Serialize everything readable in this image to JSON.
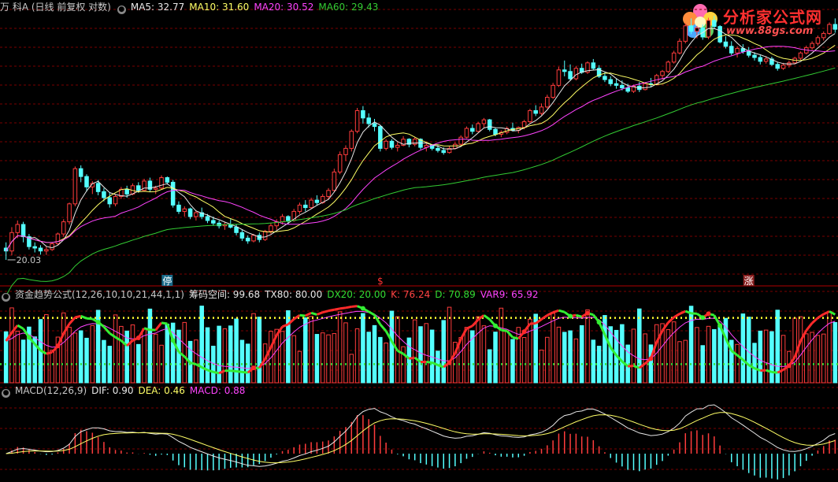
{
  "colors": {
    "background": "#000000",
    "grid": "#7a0000",
    "up": "#ff3c3c",
    "down": "#54ffff",
    "ma5": "#e8e8e8",
    "ma10": "#ffff66",
    "ma20": "#ff44ff",
    "ma60": "#33cc33",
    "label_gray": "#c8c8c8"
  },
  "header": {
    "title": "万 科A (日线 前复权 对数)",
    "ma5": "MA5: 32.77",
    "ma10": "MA10: 31.60",
    "ma20": "MA20: 30.52",
    "ma60": "MA60: 29.43"
  },
  "panel2": {
    "title": "资金趋势公式(12,26,10,10,21,44,1,1)",
    "chip": "筹码空间: 99.68",
    "tx80": "TX80: 80.00",
    "dx20": "DX20: 20.00",
    "k": "K: 76.24",
    "d": "D: 70.89",
    "var9": "VAR9: 65.92"
  },
  "panel3": {
    "title": "MACD(12,26,9)",
    "dif": "DIF: 0.90",
    "dea": "DEA: 0.46",
    "macd": "MACD: 0.88"
  },
  "logo": {
    "name": "分析家公式网",
    "url": "www.88gs.com"
  },
  "chart_data": {
    "type": "candlestick",
    "price_scale": "log",
    "low_label": "20.03",
    "markers": [
      {
        "index": 28,
        "text": "停"
      },
      {
        "index": 65,
        "text": "$"
      },
      {
        "index": 129,
        "text": "涨"
      }
    ],
    "candles": [
      [
        20.5,
        20.9,
        19.7,
        20.3
      ],
      [
        20.3,
        22.0,
        20.0,
        21.6
      ],
      [
        21.6,
        22.5,
        21.2,
        22.2
      ],
      [
        22.2,
        22.4,
        20.9,
        21.3
      ],
      [
        21.3,
        21.5,
        20.4,
        20.6
      ],
      [
        20.6,
        20.9,
        20.2,
        20.5
      ],
      [
        20.5,
        20.7,
        20.05,
        20.3
      ],
      [
        20.3,
        20.6,
        20.03,
        20.4
      ],
      [
        20.4,
        20.9,
        20.3,
        20.8
      ],
      [
        20.8,
        21.6,
        20.7,
        21.5
      ],
      [
        21.5,
        22.6,
        21.3,
        22.4
      ],
      [
        22.4,
        23.9,
        22.2,
        23.8
      ],
      [
        23.8,
        27.0,
        23.6,
        26.8
      ],
      [
        26.8,
        27.1,
        25.6,
        26.1
      ],
      [
        26.1,
        26.3,
        24.8,
        25.2
      ],
      [
        25.2,
        25.7,
        24.6,
        25.5
      ],
      [
        25.5,
        25.8,
        24.5,
        24.8
      ],
      [
        24.8,
        25.1,
        24.0,
        24.3
      ],
      [
        24.3,
        24.7,
        23.5,
        23.8
      ],
      [
        23.8,
        24.6,
        23.6,
        24.4
      ],
      [
        24.4,
        25.2,
        24.2,
        25.0
      ],
      [
        25.0,
        25.3,
        24.3,
        24.6
      ],
      [
        24.6,
        25.5,
        24.5,
        25.3
      ],
      [
        25.3,
        25.6,
        24.7,
        24.9
      ],
      [
        24.9,
        25.9,
        24.8,
        25.7
      ],
      [
        25.7,
        26.0,
        24.8,
        25.0
      ],
      [
        25.0,
        25.3,
        24.6,
        25.1
      ],
      [
        25.1,
        26.2,
        25.0,
        26.0
      ],
      [
        26.0,
        26.1,
        25.4,
        25.6
      ],
      [
        25.6,
        25.8,
        23.5,
        23.7
      ],
      [
        23.7,
        24.0,
        23.0,
        23.2
      ],
      [
        23.2,
        23.6,
        22.8,
        23.4
      ],
      [
        23.4,
        23.5,
        22.6,
        22.8
      ],
      [
        22.8,
        23.3,
        22.5,
        23.1
      ],
      [
        23.1,
        23.5,
        22.6,
        22.8
      ],
      [
        22.8,
        23.0,
        22.3,
        22.5
      ],
      [
        22.5,
        22.8,
        22.1,
        22.3
      ],
      [
        22.3,
        22.5,
        21.9,
        22.1
      ],
      [
        22.1,
        22.4,
        21.8,
        22.2
      ],
      [
        22.2,
        22.6,
        21.9,
        22.0
      ],
      [
        22.0,
        22.2,
        21.4,
        21.6
      ],
      [
        21.6,
        21.8,
        21.0,
        21.2
      ],
      [
        21.2,
        21.4,
        20.8,
        21.0
      ],
      [
        21.0,
        21.5,
        20.9,
        21.4
      ],
      [
        21.4,
        21.6,
        20.9,
        21.1
      ],
      [
        21.1,
        21.8,
        21.0,
        21.7
      ],
      [
        21.7,
        22.3,
        21.5,
        22.1
      ],
      [
        22.1,
        22.6,
        21.8,
        22.4
      ],
      [
        22.4,
        23.0,
        22.2,
        22.8
      ],
      [
        22.8,
        22.9,
        22.2,
        22.5
      ],
      [
        22.5,
        23.4,
        22.4,
        23.2
      ],
      [
        23.2,
        23.9,
        23.0,
        23.7
      ],
      [
        23.7,
        24.1,
        23.2,
        23.5
      ],
      [
        23.5,
        24.3,
        23.4,
        24.1
      ],
      [
        24.1,
        24.5,
        23.7,
        23.9
      ],
      [
        23.9,
        24.6,
        23.8,
        24.4
      ],
      [
        24.4,
        25.1,
        24.2,
        24.9
      ],
      [
        24.9,
        26.8,
        24.8,
        26.5
      ],
      [
        26.5,
        28.4,
        26.3,
        28.1
      ],
      [
        28.1,
        29.0,
        27.5,
        28.7
      ],
      [
        28.7,
        30.6,
        28.4,
        30.4
      ],
      [
        30.4,
        32.9,
        30.2,
        32.6
      ],
      [
        32.6,
        33.1,
        31.2,
        31.8
      ],
      [
        31.8,
        32.3,
        30.8,
        31.2
      ],
      [
        31.2,
        31.7,
        30.4,
        30.9
      ],
      [
        30.9,
        31.0,
        28.4,
        28.7
      ],
      [
        28.7,
        29.6,
        28.5,
        29.4
      ],
      [
        29.4,
        29.6,
        28.6,
        28.8
      ],
      [
        28.8,
        29.3,
        28.4,
        29.0
      ],
      [
        29.0,
        29.9,
        28.9,
        29.6
      ],
      [
        29.6,
        29.7,
        28.8,
        29.1
      ],
      [
        29.1,
        29.8,
        28.9,
        29.6
      ],
      [
        29.6,
        29.7,
        28.6,
        28.8
      ],
      [
        28.8,
        29.2,
        28.4,
        29.0
      ],
      [
        29.0,
        29.1,
        28.5,
        28.7
      ],
      [
        28.7,
        29.0,
        28.3,
        28.5
      ],
      [
        28.5,
        28.8,
        28.1,
        28.3
      ],
      [
        28.3,
        28.9,
        28.2,
        28.7
      ],
      [
        28.7,
        29.3,
        28.6,
        29.1
      ],
      [
        29.1,
        30.0,
        29.0,
        29.8
      ],
      [
        29.8,
        30.9,
        29.7,
        30.7
      ],
      [
        30.7,
        31.1,
        30.1,
        30.4
      ],
      [
        30.4,
        31.4,
        30.3,
        31.2
      ],
      [
        31.2,
        31.8,
        30.8,
        31.6
      ],
      [
        31.6,
        31.7,
        30.4,
        30.6
      ],
      [
        30.6,
        30.8,
        29.9,
        30.1
      ],
      [
        30.1,
        30.5,
        29.8,
        30.3
      ],
      [
        30.3,
        30.9,
        30.1,
        30.7
      ],
      [
        30.7,
        31.3,
        30.4,
        30.5
      ],
      [
        30.5,
        30.9,
        30.2,
        30.8
      ],
      [
        30.8,
        31.6,
        30.6,
        31.4
      ],
      [
        31.4,
        32.8,
        31.3,
        32.6
      ],
      [
        32.6,
        33.2,
        32.0,
        32.3
      ],
      [
        32.3,
        33.4,
        32.1,
        33.0
      ],
      [
        33.0,
        34.4,
        32.8,
        34.1
      ],
      [
        34.1,
        35.8,
        33.9,
        35.5
      ],
      [
        35.5,
        37.8,
        35.3,
        37.4
      ],
      [
        37.4,
        38.6,
        36.6,
        37.2
      ],
      [
        37.2,
        38.1,
        36.1,
        36.3
      ],
      [
        36.3,
        37.9,
        36.1,
        37.6
      ],
      [
        37.6,
        38.2,
        36.9,
        37.1
      ],
      [
        37.1,
        38.5,
        36.9,
        38.3
      ],
      [
        38.3,
        38.8,
        37.4,
        37.6
      ],
      [
        37.6,
        38.0,
        36.4,
        36.6
      ],
      [
        36.6,
        37.1,
        35.9,
        36.2
      ],
      [
        36.2,
        36.6,
        35.4,
        35.7
      ],
      [
        35.7,
        36.3,
        35.1,
        35.5
      ],
      [
        35.5,
        36.1,
        34.9,
        35.2
      ],
      [
        35.2,
        35.7,
        34.6,
        34.8
      ],
      [
        34.8,
        35.6,
        34.6,
        35.4
      ],
      [
        35.4,
        35.9,
        34.7,
        35.0
      ],
      [
        35.0,
        35.9,
        34.9,
        35.7
      ],
      [
        35.7,
        36.4,
        35.3,
        35.6
      ],
      [
        35.6,
        36.9,
        35.5,
        36.7
      ],
      [
        36.7,
        37.4,
        36.2,
        37.2
      ],
      [
        37.2,
        38.6,
        37.0,
        38.4
      ],
      [
        38.4,
        39.9,
        38.2,
        39.6
      ],
      [
        39.6,
        41.6,
        39.4,
        41.2
      ],
      [
        41.2,
        43.8,
        40.9,
        43.4
      ],
      [
        43.4,
        44.5,
        42.2,
        42.6
      ],
      [
        42.6,
        43.4,
        41.6,
        43.1
      ],
      [
        43.1,
        43.6,
        41.4,
        41.8
      ],
      [
        41.8,
        44.6,
        41.5,
        44.2
      ],
      [
        44.2,
        44.9,
        42.9,
        43.3
      ],
      [
        43.3,
        43.5,
        40.9,
        41.1
      ],
      [
        41.1,
        41.9,
        40.2,
        40.5
      ],
      [
        40.5,
        41.2,
        39.3,
        39.6
      ],
      [
        39.6,
        40.5,
        39.0,
        40.2
      ],
      [
        40.2,
        40.8,
        39.5,
        39.8
      ],
      [
        39.8,
        40.4,
        39.0,
        39.3
      ],
      [
        39.3,
        39.7,
        38.6,
        39.0
      ],
      [
        39.0,
        39.3,
        38.1,
        38.5
      ],
      [
        38.5,
        39.2,
        38.2,
        38.8
      ],
      [
        38.8,
        39.1,
        37.9,
        38.1
      ],
      [
        38.1,
        38.4,
        37.3,
        37.6
      ],
      [
        37.6,
        38.3,
        37.4,
        38.0
      ],
      [
        38.0,
        38.6,
        37.7,
        38.3
      ],
      [
        38.3,
        39.1,
        38.1,
        38.9
      ],
      [
        38.9,
        39.8,
        38.7,
        39.6
      ],
      [
        39.6,
        40.6,
        39.4,
        40.3
      ],
      [
        40.3,
        41.2,
        40.0,
        40.9
      ],
      [
        40.9,
        42.0,
        40.6,
        41.7
      ],
      [
        41.7,
        42.6,
        41.3,
        42.3
      ],
      [
        42.3,
        43.9,
        42.1,
        43.6
      ],
      [
        43.6,
        44.5,
        42.4,
        42.9
      ]
    ]
  }
}
